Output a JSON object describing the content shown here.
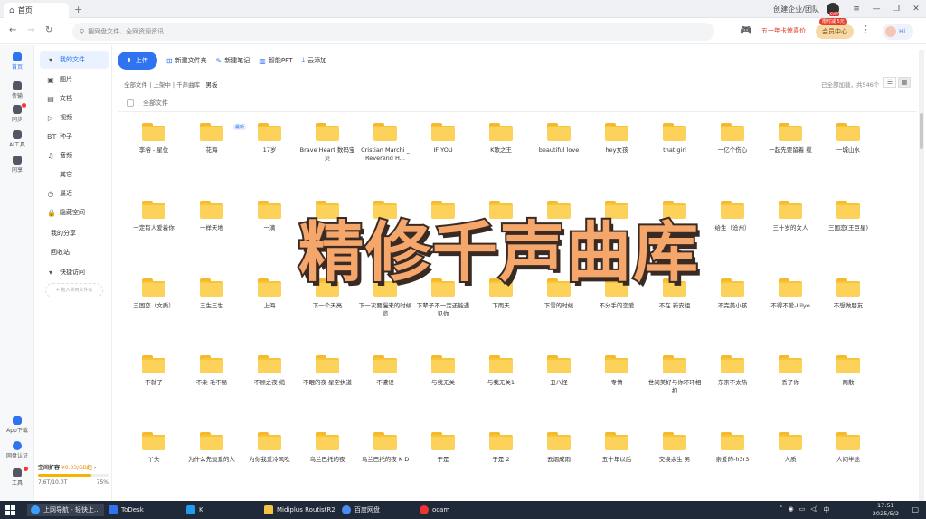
{
  "tab": {
    "label": "首页"
  },
  "topright": {
    "team_label": "创建企业/团队"
  },
  "address": {
    "placeholder": "搜网盘文件、全网资源资讯"
  },
  "promo": {
    "year_offer": "五一年卡惊喜价",
    "vip_button": "会员中心",
    "vip_badge": "限时减 5元",
    "hi": "Hi"
  },
  "rail": {
    "items": [
      {
        "label": "首页",
        "icon": "home-icon"
      },
      {
        "label": "传输",
        "icon": "transfer-icon"
      },
      {
        "label": "同步",
        "icon": "sync-icon"
      },
      {
        "label": "AI工具",
        "icon": "ai-tools-icon"
      },
      {
        "label": "同享",
        "icon": "share-icon"
      },
      {
        "label": "App下载",
        "icon": "app-download-icon"
      },
      {
        "label": "网盘认证",
        "icon": "verify-icon"
      },
      {
        "label": "工具",
        "icon": "tools-icon"
      }
    ]
  },
  "sidebar": {
    "my_files": "我的文件",
    "items": [
      "图片",
      "文档",
      "视频",
      "种子",
      "音频",
      "其它",
      "最近",
      "隐藏空间"
    ],
    "my_share": "我的分享",
    "recycle": "回收站",
    "quick": "快捷访问",
    "add_fav": "+ 拖入常用文件夹"
  },
  "quota": {
    "title": "空间扩容",
    "price": "¥0.03/GB起",
    "used": "7.6T/10.0T",
    "percent": "75%",
    "fill": 0.75
  },
  "toolbar": {
    "upload": "上传",
    "new_folder": "新建文件夹",
    "new_note": "新建笔记",
    "ppt": "智能PPT",
    "cloud_add": "云添加"
  },
  "breadcrumb": {
    "path": "全部文件 | 上架中 | 千声曲库 |",
    "current": "男板"
  },
  "count_text": "已全部加载，共546个",
  "header": {
    "all_files": "全部文件"
  },
  "new_tag": "最新",
  "overlay_text": "精修千声曲库",
  "folders": [
    [
      "李榕 - 星位",
      "花海",
      "17岁",
      "Brave Heart 数码宝贝",
      "Cristian Marchi _ Reverend H...",
      "IF YOU",
      "K歌之王",
      "beautiful love",
      "hey女孩",
      "that girl",
      "一亿个伤心",
      "一起先要留着 缆",
      "一城山水"
    ],
    [
      "一定有人爱着你",
      "一样天地",
      "一滴",
      "",
      "",
      "",
      "",
      "",
      "",
      "",
      "给生（沧州）",
      "三十岁的女人",
      "三国恋(王巨星)"
    ],
    [
      "三国恋（文质）",
      "三生三世",
      "上海",
      "下一个天亮",
      "下一次要慢来的时候 缆",
      "下辈子不一定还能遇见你",
      "下雨天",
      "下雪的时候",
      "不分手的恋爱",
      "不在 新安组",
      "不完美小孩",
      "不得不爱-Lilyo",
      "不想做朋友"
    ],
    [
      "不就了",
      "不染 毛不易",
      "不顾之夜 缆",
      "不眠的夜 星空执道",
      "不遭误",
      "与我无关",
      "与我无关1",
      "丑八怪",
      "专情",
      "世间美好与你环环相扣",
      "东京不太热",
      "丢了你",
      "两散"
    ],
    [
      "丫头",
      "为什么先淡爱的人",
      "为你我爱冷风吹",
      "乌兰巴托的夜",
      "乌兰巴托的夜 K D",
      "于是",
      "于是 2",
      "云烟成雨",
      "五十年以后",
      "交换余生 男",
      "亲爱的-h3r3",
      "人质",
      "人间半途"
    ]
  ],
  "taskbar": {
    "items": [
      {
        "label": "上网导航 - 轻快上...",
        "icon": "browser-icon"
      },
      {
        "label": "ToDesk",
        "icon": "todesk-icon"
      },
      {
        "label": "K",
        "icon": "k-app-icon"
      },
      {
        "label": "Midiplus RoutistR2",
        "icon": "folder-icon"
      },
      {
        "label": "百度网盘",
        "icon": "baidu-netdisk-icon"
      },
      {
        "label": "ocam",
        "icon": "ocam-icon"
      }
    ],
    "ime": "中",
    "time": "17:51",
    "date": "2025/5/2"
  }
}
